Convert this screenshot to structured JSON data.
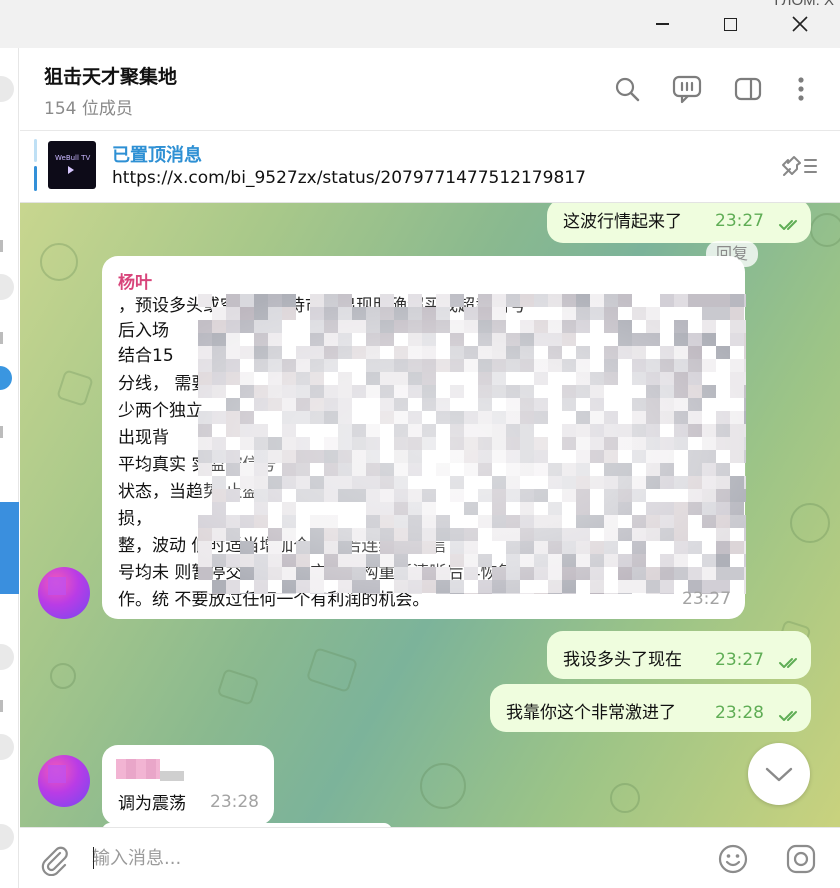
{
  "window": {
    "peek_text": "ГЛОМ: Х",
    "controls": [
      "minimize",
      "maximize",
      "close"
    ]
  },
  "header": {
    "title": "狙击天才聚集地",
    "subtitle": "154 位成员",
    "icons": [
      "search-icon",
      "video-chat-icon",
      "sidebar-toggle-icon",
      "more-menu-icon"
    ]
  },
  "pinned": {
    "label": "已置顶消息",
    "text": "https://x.com/bi_9527zx/status/2079771477512179817",
    "thumbnail_text": "WeBull TV"
  },
  "messages": [
    {
      "id": "m1",
      "direction": "out",
      "text": "这波行情起来了",
      "time": "23:27",
      "read": true
    },
    {
      "id": "m2",
      "direction": "in",
      "sender": "杨叶",
      "reply_label": "回复",
      "lines": [
        "                    ，预设多头或空头，等待市场出现明确超买或超卖信号",
        "后入场",
        "",
        "                                                               结合15",
        "分线，                                                     需要至",
        "少两个独立",
        "出现背",
        "平均真实                                                  实监控信号",
        "状态，当趋势                                             止盈止",
        "损，",
        "整，波动                                                低时适当增加仓位，若连续三次信",
        "号均未                     则暂停交易，等待市场结构重新清晰后再恢复操",
        "作。统                          不要放过任何一个有利润的机会。"
      ],
      "time": "23:27"
    },
    {
      "id": "m3",
      "direction": "out",
      "text": "我设多头了现在",
      "time": "23:27",
      "read": true
    },
    {
      "id": "m4",
      "direction": "out",
      "text": "我靠你这个非常激进了",
      "time": "23:28",
      "read": true
    },
    {
      "id": "m5",
      "direction": "in",
      "sender": "",
      "text": "调为震荡",
      "time": "23:28"
    }
  ],
  "composer": {
    "placeholder": "输入消息..."
  },
  "colors": {
    "accent": "#2e90d4",
    "sender_name": "#d8457b",
    "outgoing_bubble": "#effdde",
    "outgoing_time": "#5fad55",
    "incoming_time": "#a3a3a3"
  }
}
